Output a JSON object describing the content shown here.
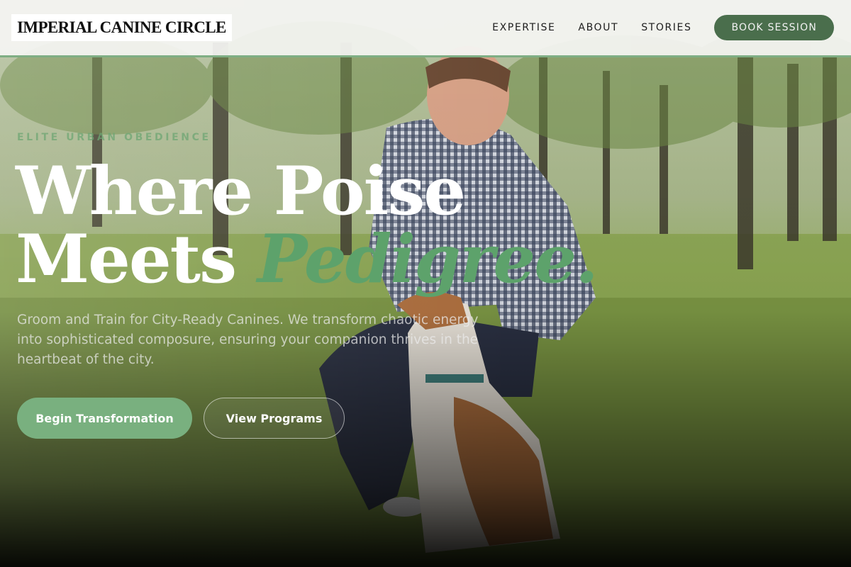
{
  "header": {
    "logo": "IMPERIAL CANINE CIRCLE",
    "nav": [
      "EXPERTISE",
      "ABOUT",
      "STORIES"
    ],
    "cta": "BOOK SESSION"
  },
  "hero": {
    "eyebrow": "ELITE URBAN OBEDIENCE",
    "headline_line1": "Where Poise",
    "headline_line2_plain": "Meets ",
    "headline_line2_accent": "Pedigree.",
    "subtitle": "Groom and Train for City-Ready Canines. We transform chaotic energy into sophisticated composure, ensuring your companion thrives in the heartbeat of the city.",
    "primary_button": "Begin Transformation",
    "secondary_button": "View Programs",
    "background_image": "man-kneeling-with-dog-in-park"
  },
  "colors": {
    "accent_green": "#79b07f",
    "dark_green": "#4a6e4c",
    "header_border": "#7fae84"
  }
}
